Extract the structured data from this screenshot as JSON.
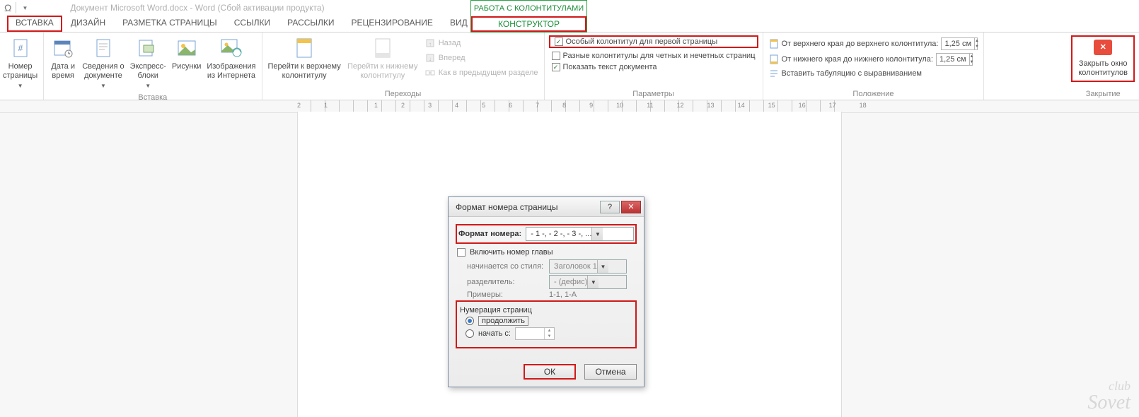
{
  "title": {
    "omega": "Ω",
    "doc": "Документ Microsoft Word.docx - Word (Сбой активации продукта)"
  },
  "tabs": {
    "vstavka": "ВСТАВКА",
    "design": "ДИЗАЙН",
    "layout": "РАЗМЕТКА СТРАНИЦЫ",
    "refs": "ССЫЛКИ",
    "mail": "РАССЫЛКИ",
    "review": "РЕЦЕНЗИРОВАНИЕ",
    "view": "ВИД",
    "ctx_title": "РАБОТА С КОЛОНТИТУЛАМИ",
    "ctx_tab": "КОНСТРУКТОР"
  },
  "ribbon": {
    "page_number": "Номер\nстраницы",
    "date_time": "Дата и\nвремя",
    "doc_info": "Сведения о\nдокументе",
    "quick_parts": "Экспресс-\nблоки",
    "pictures": "Рисунки",
    "online_pics": "Изображения\nиз Интернета",
    "group_insert": "Вставка",
    "goto_header": "Перейти к верхнему\nколонтитулу",
    "goto_footer": "Перейти к нижнему\nколонтитулу",
    "nav_back": "Назад",
    "nav_fwd": "Вперед",
    "nav_prev": "Как в предыдущем разделе",
    "group_nav": "Переходы",
    "opt_first": "Особый колонтитул для первой страницы",
    "opt_oddeven": "Разные колонтитулы для четных и нечетных страниц",
    "opt_showdoc": "Показать текст документа",
    "group_opts": "Параметры",
    "pos_top": "От верхнего края до верхнего колонтитула:",
    "pos_bot": "От нижнего края до нижнего колонтитула:",
    "pos_tab": "Вставить табуляцию с выравниванием",
    "pos_val": "1,25 см",
    "group_pos": "Положение",
    "close": "Закрыть окно\nколонтитулов",
    "group_close": "Закрытие"
  },
  "ruler": {
    "marks": [
      "2",
      "1",
      "",
      "1",
      "2",
      "3",
      "4",
      "5",
      "6",
      "7",
      "8",
      "9",
      "10",
      "11",
      "12",
      "13",
      "14",
      "15",
      "16",
      "17",
      "18"
    ]
  },
  "dialog": {
    "title": "Формат номера страницы",
    "fmt_label": "Формат номера:",
    "fmt_value": "- 1 -, - 2 -, - 3 -, ...",
    "chapter_chk": "Включить номер главы",
    "starts_with": "начинается со стиля:",
    "starts_with_val": "Заголовок 1",
    "separator": "разделитель:",
    "separator_val": "-      (дефис)",
    "examples": "Примеры:",
    "examples_val": "1-1, 1-A",
    "numbering_title": "Нумерация страниц",
    "radio_continue": "продолжить",
    "radio_startat": "начать с:",
    "ok": "ОК",
    "cancel": "Отмена"
  },
  "watermark": {
    "line1": "club",
    "line2": "Sovet"
  }
}
